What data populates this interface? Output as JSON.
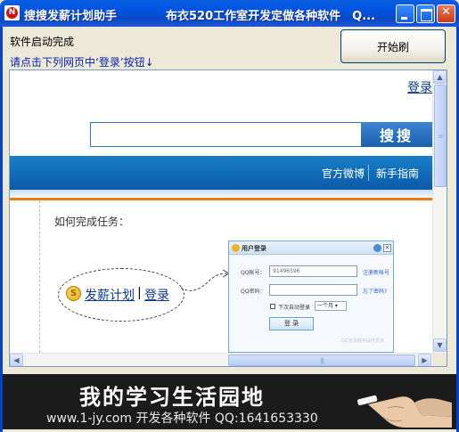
{
  "window": {
    "title": "搜搜发薪计划助手",
    "title_center": "布衣520工作室开发定做各种软件　Q...",
    "app_icon_letter": "N"
  },
  "status_text": "软件启动完成",
  "hint_text": "请点击下列网页中‘登录’按钮↓",
  "start_button": "开始刷",
  "webpage": {
    "login_top": "登录",
    "search_value": "",
    "search_button": "搜搜",
    "nav": [
      "官方微博",
      "新手指南"
    ],
    "howto": "如何完成任务：",
    "plan_link": "发薪计划",
    "separator": "|",
    "login_link": "登录",
    "login_dialog": {
      "title": "用户登录",
      "qq_label": "QQ帐号：",
      "qq_value": "91496596",
      "qq_link": "注册新帐号",
      "pwd_label": "QQ密码：",
      "pwd_link": "忘了密码?",
      "auto_login": "下次自动登录",
      "duration": "一个月",
      "login_button": "登 录",
      "footer": "QQ登录服务提供支持"
    }
  },
  "banner": {
    "title": "我的学习生活园地",
    "subtitle": "www.1-jy.com 开发各种软件 QQ:1641653330"
  }
}
